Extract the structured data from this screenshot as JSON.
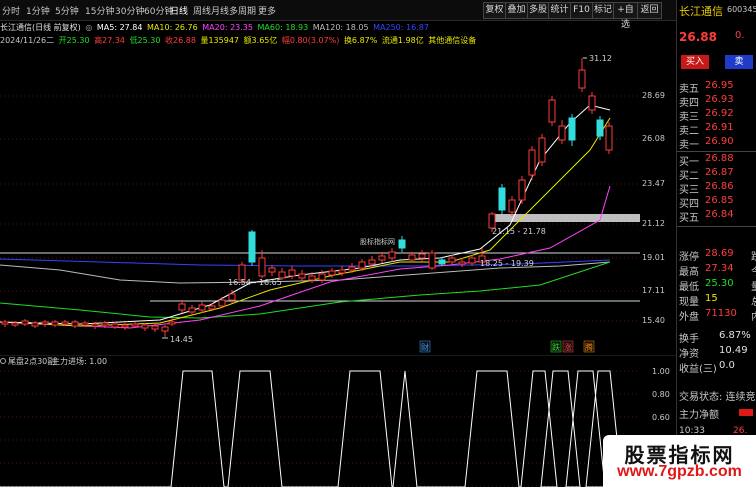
{
  "toolbar": {
    "periods": [
      "分时",
      "1分钟",
      "5分钟",
      "15分钟",
      "30分钟",
      "60分钟",
      "日线",
      "周线",
      "月线",
      "多周期",
      "更多"
    ],
    "active_period": "日线",
    "buttons": [
      "复权",
      "叠加",
      "多股",
      "统计",
      "F10",
      "标记",
      "+自选",
      "返回"
    ]
  },
  "info_line1": {
    "stock": "长江通信(日线 前复权)",
    "ma5": "MA5: 27.84",
    "ma10": "MA10: 26.76",
    "ma20": "MA20: 23.35",
    "ma60": "MA60: 18.93",
    "ma120": "MA120: 18.05",
    "ma250": "MA250: 16.87"
  },
  "info_line2": {
    "date": "2024/11/26二",
    "open": "开25.30",
    "high": "高27.34",
    "low": "低25.30",
    "close": "收26.88",
    "volume": "量135947",
    "amount": "额3.65亿",
    "change": "幅0.80(3.07%)",
    "turnover": "换6.87%",
    "float": "流通1.98亿",
    "sector": "其他通信设备"
  },
  "price_axis": [
    "28.69",
    "26.08",
    "23.47",
    "21.12",
    "19.01",
    "17.11",
    "15.40"
  ],
  "annotations": {
    "high_mark": "31.12",
    "low_mark": "14.45",
    "zone1": "21.15 - 21.78",
    "zone2": "18.25 - 19.39",
    "zone3": "16.54 - 16.65",
    "logo_text": "股标指标网",
    "tag_cai": "财",
    "tag_die": "跌",
    "tag_zhang": "涨",
    "tag_teng": "腾"
  },
  "indicator": {
    "title": "尾盘2点30副",
    "line": "主力进场: 1.00",
    "axis": [
      "1.00",
      "0.80",
      "0.60",
      "0.40",
      "0.20",
      "0.00"
    ],
    "pulses": [
      {
        "rise": 183,
        "fall": 212
      },
      {
        "rise": 240,
        "fall": 270
      },
      {
        "rise": 350,
        "fall": 380
      },
      {
        "rise": 405,
        "fall": 405
      },
      {
        "rise": 477,
        "fall": 507
      },
      {
        "rise": 533,
        "fall": 545
      },
      {
        "rise": 553,
        "fall": 568
      },
      {
        "rise": 578,
        "fall": 593
      },
      {
        "rise": 598,
        "fall": 610
      }
    ]
  },
  "quote_panel": {
    "name": "长江通信",
    "code": "600345",
    "code_flag": "R",
    "price": "26.88",
    "price_change": "0.",
    "buy_label": "买入",
    "sell_label": "卖",
    "asks": [
      {
        "label": "卖五",
        "price": "26.95",
        "vol": ""
      },
      {
        "label": "卖四",
        "price": "26.93",
        "vol": ""
      },
      {
        "label": "卖三",
        "price": "26.92",
        "vol": ""
      },
      {
        "label": "卖二",
        "price": "26.91",
        "vol": ""
      },
      {
        "label": "卖一",
        "price": "26.90",
        "vol": ""
      }
    ],
    "bids": [
      {
        "label": "买一",
        "price": "26.88",
        "vol": ""
      },
      {
        "label": "买二",
        "price": "26.87",
        "vol": ""
      },
      {
        "label": "买三",
        "price": "26.86",
        "vol": ""
      },
      {
        "label": "买四",
        "price": "26.85",
        "vol": ""
      },
      {
        "label": "买五",
        "price": "26.84",
        "vol": ""
      }
    ],
    "stats": [
      {
        "label": "涨停",
        "value": "28.69",
        "extra": "跌"
      },
      {
        "label": "最高",
        "value": "27.34",
        "extra": "今"
      },
      {
        "label": "最低",
        "value": "25.30",
        "extra": "量"
      },
      {
        "label": "现量",
        "value": "15",
        "extra": "总"
      },
      {
        "label": "外盘",
        "value": "71130",
        "extra": "内"
      }
    ],
    "stats2": [
      {
        "label": "换手",
        "value": "6.87%"
      },
      {
        "label": "净资",
        "value": "10.49"
      },
      {
        "label": "收益(三)",
        "value": "0.0"
      }
    ],
    "trade_status": "交易状态: 连续竞价",
    "main_force": "主力净额",
    "time": "10:33",
    "time_price": "26."
  },
  "watermark": {
    "line1": "股票指标网",
    "line2": "www.7gpzb.com"
  },
  "colors": {
    "up": "#ff3c3c",
    "down": "#33dddd",
    "ma5": "#ffffff",
    "ma10": "#e6e600",
    "ma20": "#ff44ff",
    "ma60": "#22dd22",
    "ma120": "#bbbbbb",
    "ma250": "#3344ff",
    "grey_band": "#bfbfbf"
  }
}
